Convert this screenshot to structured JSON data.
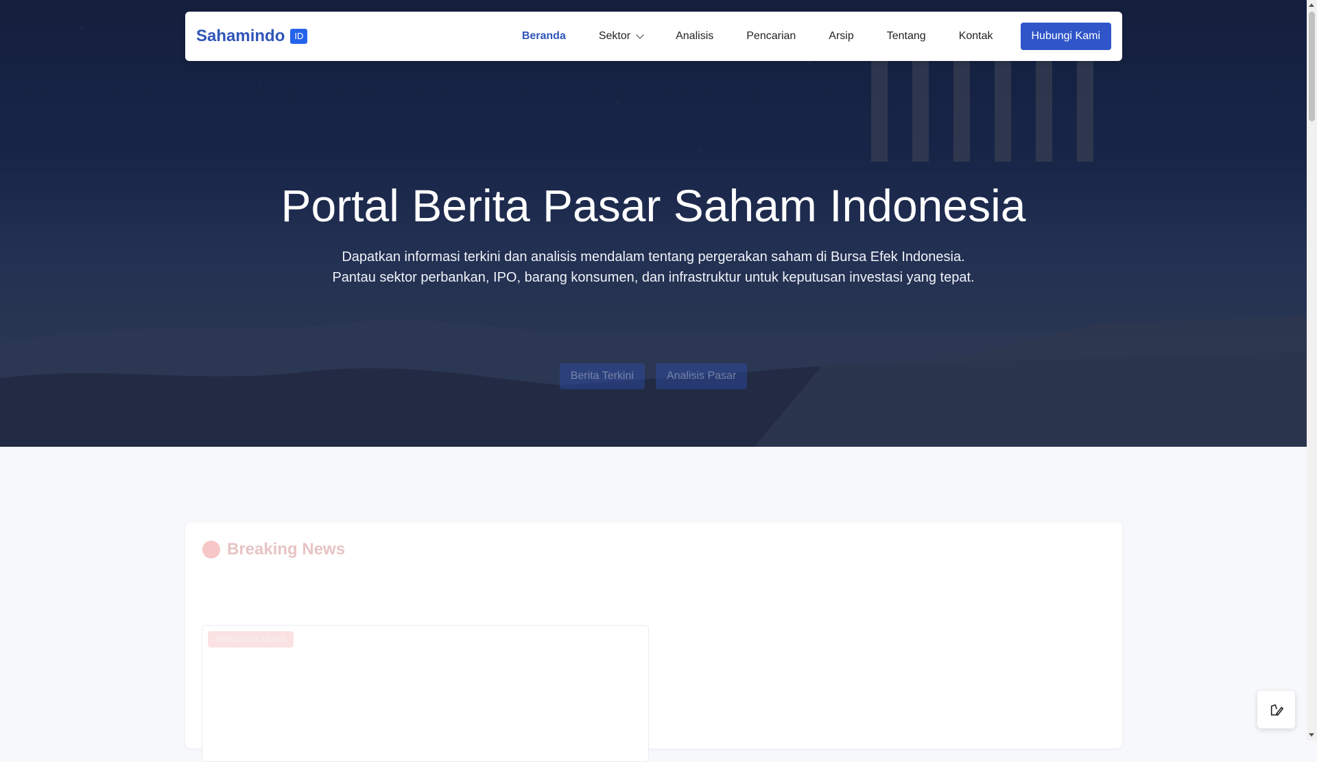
{
  "nav": {
    "brand_name": "Sahamindo",
    "brand_badge": "ID",
    "links": [
      {
        "label": "Beranda",
        "active": true
      },
      {
        "label": "Sektor",
        "dropdown": true
      },
      {
        "label": "Analisis"
      },
      {
        "label": "Pencarian"
      },
      {
        "label": "Arsip"
      },
      {
        "label": "Tentang"
      },
      {
        "label": "Kontak"
      }
    ],
    "cta_label": "Hubungi Kami"
  },
  "hero": {
    "title": "Portal Berita Pasar Saham Indonesia",
    "subtitle_line1": "Dapatkan informasi terkini dan analisis mendalam tentang pergerakan saham di Bursa Efek Indonesia.",
    "subtitle_line2": "Pantau sektor perbankan, IPO, barang konsumen, dan infrastruktur untuk keputusan investasi yang tepat.",
    "buttons": [
      "Berita Terkini",
      "Analisis Pasar"
    ]
  },
  "breaking": {
    "title": "Breaking News",
    "tag": "BREAKING NEWS"
  },
  "icons": {
    "float_button": "palette-brush-icon"
  },
  "colors": {
    "brand": "#2f55b8",
    "cta": "#2f55c8"
  }
}
